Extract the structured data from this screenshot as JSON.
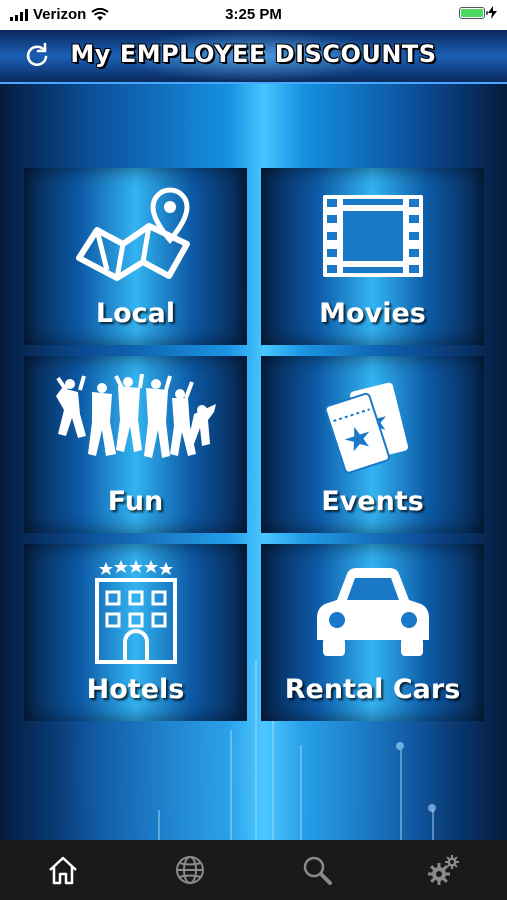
{
  "status_bar": {
    "carrier": "Verizon",
    "time": "3:25 PM",
    "battery_level": 1.0
  },
  "header": {
    "title_prefix": "My",
    "title_main": "EMPLOYEE DISCOUNTS",
    "refresh_icon": "refresh-icon"
  },
  "tiles": [
    {
      "label": "Local",
      "icon": "map-pin-icon"
    },
    {
      "label": "Movies",
      "icon": "film-strip-icon"
    },
    {
      "label": "Fun",
      "icon": "people-jumping-icon"
    },
    {
      "label": "Events",
      "icon": "tickets-icon"
    },
    {
      "label": "Hotels",
      "icon": "hotel-icon"
    },
    {
      "label": "Rental Cars",
      "icon": "car-icon"
    }
  ],
  "tabbar": [
    {
      "name": "home",
      "icon": "home-icon"
    },
    {
      "name": "web",
      "icon": "globe-icon"
    },
    {
      "name": "search",
      "icon": "search-icon"
    },
    {
      "name": "settings",
      "icon": "gear-icon"
    }
  ],
  "colors": {
    "accent": "#1590e0",
    "tab_bar_bg": "#1a1a1a",
    "battery": "#4cd964"
  }
}
